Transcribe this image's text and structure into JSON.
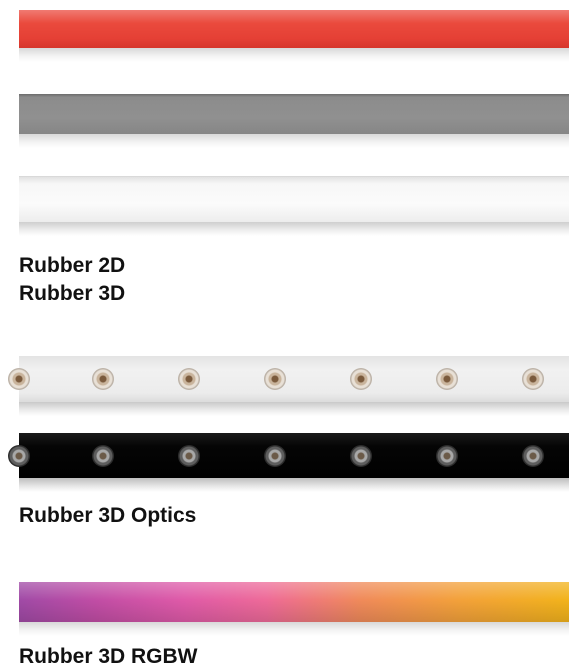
{
  "labels": {
    "rubber_2d": "Rubber 2D",
    "rubber_3d": "Rubber 3D",
    "rubber_3d_optics": "Rubber 3D Optics",
    "rubber_3d_rgbw": "Rubber 3D RGBW"
  },
  "strips": [
    {
      "name": "red",
      "color": "#e8453a"
    },
    {
      "name": "grey",
      "color": "#8c8c8c"
    },
    {
      "name": "white",
      "color": "#f7f7f7"
    },
    {
      "name": "optics-white",
      "color": "#eeeeee",
      "led_count": 7
    },
    {
      "name": "optics-black",
      "color": "#000000",
      "led_count": 7
    },
    {
      "name": "rgbw",
      "colors": [
        "#a04aa6",
        "#df5aa8",
        "#f08a5a",
        "#f2b31b"
      ]
    }
  ]
}
